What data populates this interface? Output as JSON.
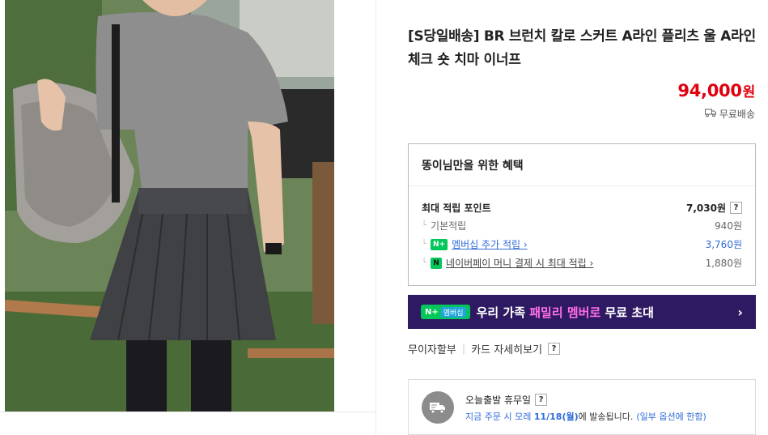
{
  "product": {
    "title": "[S당일배송] BR 브런치 칼로 스커트 A라인 플리츠 울 A라인 체크 숏 치마 이너프",
    "price_number": "94,000",
    "price_unit": "원",
    "shipping": "무료배송"
  },
  "benefits": {
    "heading": "똥이님만을 위한 혜택",
    "max_point_label": "최대 적립 포인트",
    "max_point_value": "7,030원",
    "help": "?",
    "rows": [
      {
        "label": "기본적립",
        "value": "940원"
      },
      {
        "badge": "N+",
        "label": "멤버십 추가 적립 ›",
        "value": "3,760원"
      },
      {
        "badge": "N",
        "label": "네이버페이 머니 결제 시 최대 적립 ›",
        "value": "1,880원"
      }
    ]
  },
  "banner": {
    "badge_main": "N+",
    "badge_sub": "멤버십",
    "text_pre": "우리 가족 ",
    "text_highlight": "패밀리 멤버로",
    "text_post": " 무료 초대",
    "chevron": "›"
  },
  "installment": {
    "left": "무이자할부",
    "right": "카드 자세히보기",
    "help": "?"
  },
  "delivery": {
    "title": "오늘출발 휴무일",
    "help": "?",
    "text_pre": "지금 주문 시 모레 ",
    "date": "11/18(월)",
    "text_post": "에 발송됩니다.",
    "note": "(일부 옵션에 한함)"
  },
  "colors": {
    "price": "#e1000f",
    "banner_bg": "#2e1a63",
    "banner_highlight": "#ff6ee8",
    "naver_green": "#03c75a",
    "link_blue": "#2f6bd9"
  }
}
